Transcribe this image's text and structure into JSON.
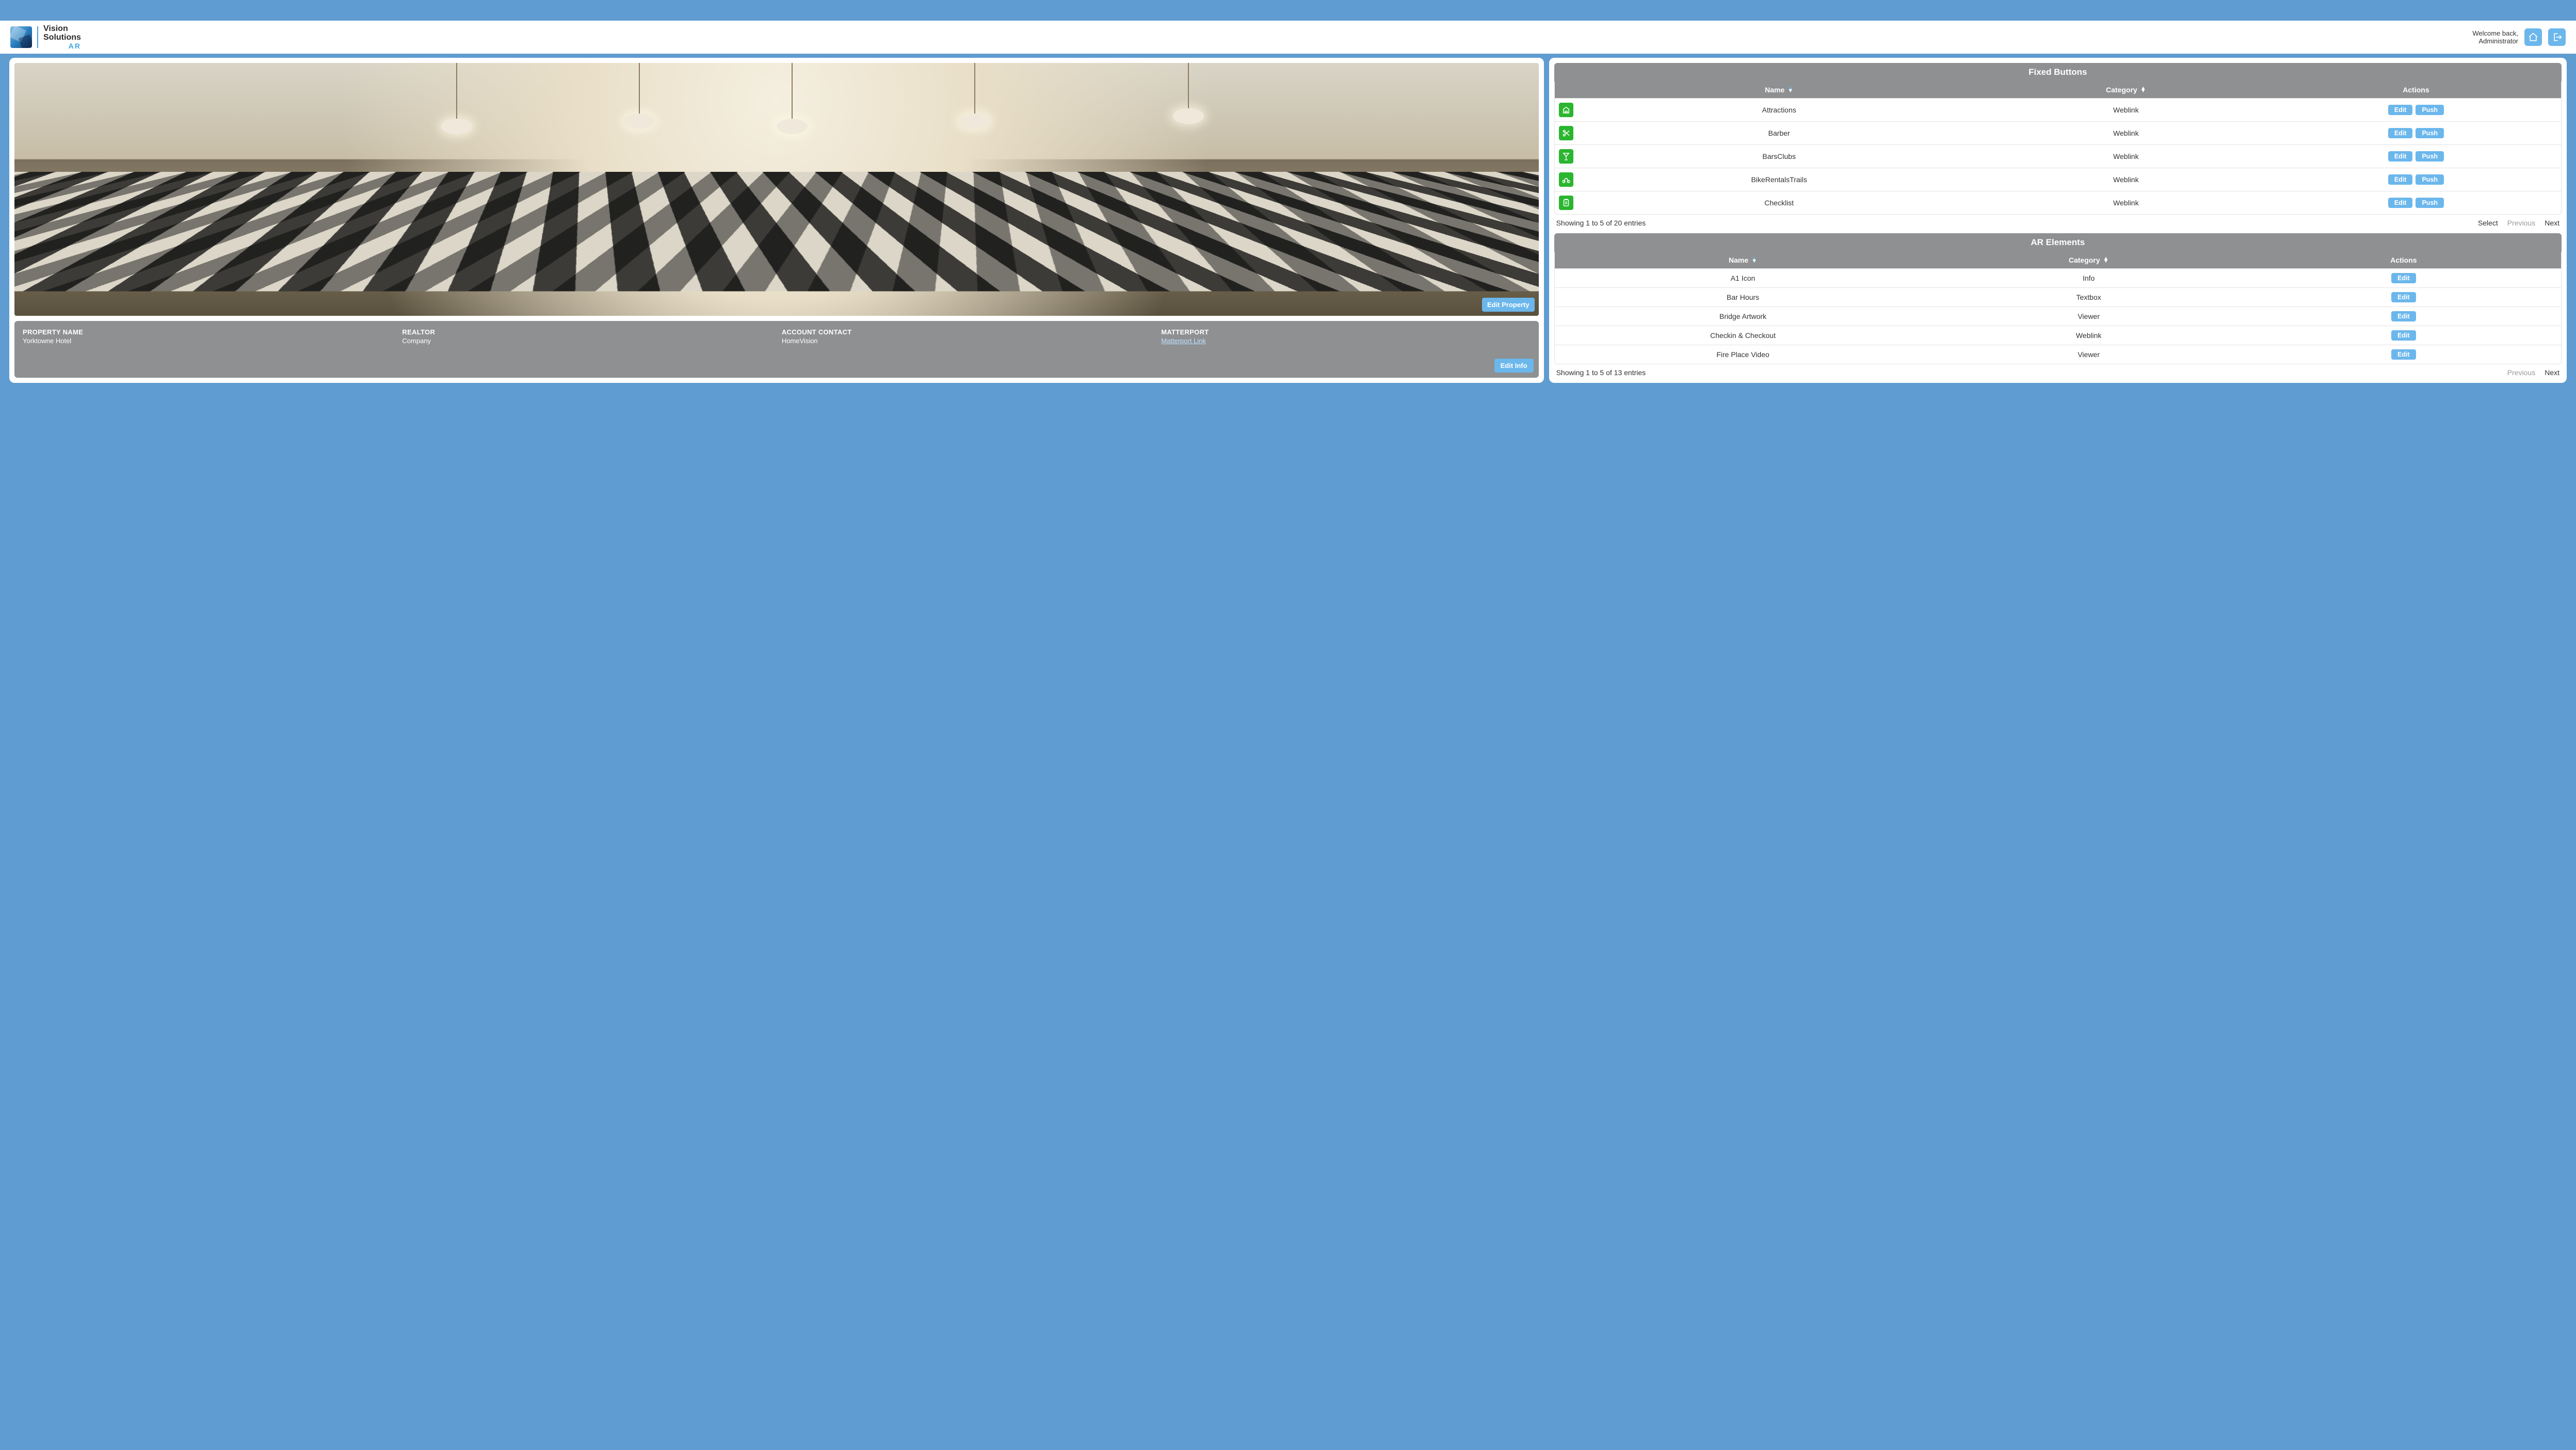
{
  "brand": {
    "line1": "Vision",
    "line2": "Solutions",
    "line3": "AR"
  },
  "header": {
    "welcome_line1": "Welcome back,",
    "welcome_line2": "Administrator"
  },
  "buttons": {
    "edit_property": "Edit Property",
    "edit_info": "Edit Info",
    "edit": "Edit",
    "push": "Push",
    "select": "Select",
    "prev": "Previous",
    "next": "Next"
  },
  "property": {
    "image_alt": "Hotel lobby and bar area with checkered floor and pendant lights",
    "fields": [
      {
        "label": "PROPERTY NAME",
        "value": "Yorktowne Hotel"
      },
      {
        "label": "REALTOR",
        "value": "Company"
      },
      {
        "label": "ACCOUNT CONTACT",
        "value": "HomeVision"
      },
      {
        "label": "MATTERPORT",
        "value": "Matterport Link",
        "is_link": true
      }
    ]
  },
  "fixed_buttons": {
    "title": "Fixed Buttons",
    "columns": [
      "Name",
      "Category",
      "Actions"
    ],
    "rows": [
      {
        "icon": "landmark",
        "name": "Attractions",
        "category": "Weblink"
      },
      {
        "icon": "scissors",
        "name": "Barber",
        "category": "Weblink"
      },
      {
        "icon": "cocktail",
        "name": "BarsClubs",
        "category": "Weblink"
      },
      {
        "icon": "bike",
        "name": "BikeRentalsTrails",
        "category": "Weblink"
      },
      {
        "icon": "clipboard",
        "name": "Checklist",
        "category": "Weblink"
      }
    ],
    "summary": "Showing 1 to 5 of 20 entries"
  },
  "ar_elements": {
    "title": "AR Elements",
    "columns": [
      "Name",
      "Category",
      "Actions"
    ],
    "rows": [
      {
        "name": "A1 Icon",
        "category": "Info"
      },
      {
        "name": "Bar Hours",
        "category": "Textbox"
      },
      {
        "name": "Bridge Artwork",
        "category": "Viewer"
      },
      {
        "name": "Checkin & Checkout",
        "category": "Weblink"
      },
      {
        "name": "Fire Place Video",
        "category": "Viewer"
      }
    ],
    "summary": "Showing 1 to 5 of 13 entries"
  }
}
